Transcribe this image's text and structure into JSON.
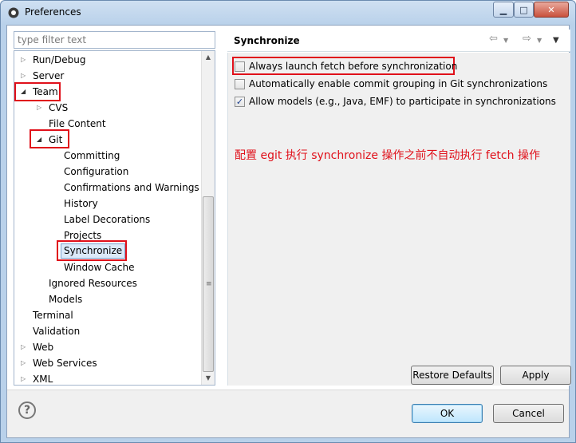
{
  "window": {
    "title": "Preferences"
  },
  "filter": {
    "placeholder": "type filter text"
  },
  "tree": [
    {
      "label": "Run/Debug"
    },
    {
      "label": "Server"
    },
    {
      "label": "Team"
    },
    {
      "label": "CVS"
    },
    {
      "label": "File Content"
    },
    {
      "label": "Git"
    },
    {
      "label": "Committing"
    },
    {
      "label": "Configuration"
    },
    {
      "label": "Confirmations and Warnings"
    },
    {
      "label": "History"
    },
    {
      "label": "Label Decorations"
    },
    {
      "label": "Projects"
    },
    {
      "label": "Synchronize"
    },
    {
      "label": "Window Cache"
    },
    {
      "label": "Ignored Resources"
    },
    {
      "label": "Models"
    },
    {
      "label": "Terminal"
    },
    {
      "label": "Validation"
    },
    {
      "label": "Web"
    },
    {
      "label": "Web Services"
    },
    {
      "label": "XML"
    }
  ],
  "page": {
    "title": "Synchronize",
    "options": [
      {
        "label": "Always launch fetch before synchronization",
        "checked": false
      },
      {
        "label": "Automatically enable commit grouping in Git synchronizations",
        "checked": false
      },
      {
        "label": "Allow models (e.g., Java, EMF) to participate in synchronizations",
        "checked": true
      }
    ],
    "annotation": "配置 egit 执行 synchronize 操作之前不自动执行 fetch 操作"
  },
  "buttons": {
    "restore_defaults": "Restore Defaults",
    "apply": "Apply",
    "ok": "OK",
    "cancel": "Cancel"
  },
  "colors": {
    "highlight_red": "#e0101a",
    "accent_blue": "#1c3f8c"
  }
}
